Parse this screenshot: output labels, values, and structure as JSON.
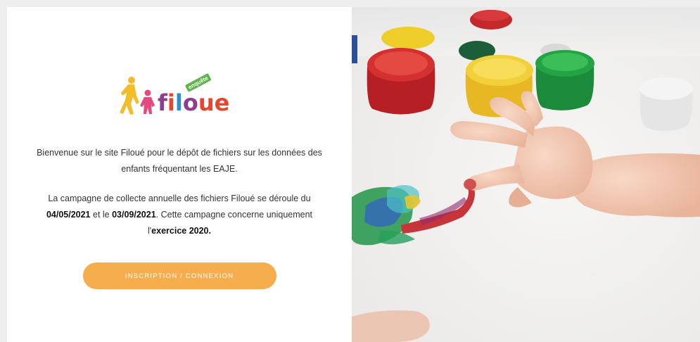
{
  "logo": {
    "word_letters": [
      "f",
      "i",
      "l",
      "o",
      "u",
      "e"
    ],
    "tag": "enquête",
    "colors": {
      "f": "#8e3d8f",
      "i": "#e6462e",
      "l": "#2c8fd1",
      "o": "#8e3d8f",
      "u": "#e6462e",
      "e": "#e6462e",
      "child_yellow": "#f2bd2c",
      "child_pink": "#e5497e",
      "tag_green": "#5bb547"
    }
  },
  "intro": {
    "line1": "Bienvenue sur le site Filoué pour le dépôt de fichiers sur les données des",
    "line2": "enfants fréquentant les EAJE."
  },
  "campaign": {
    "text1": "La campagne de collecte annuelle des fichiers Filoué se déroule du",
    "date_start": "04/05/2021",
    "text2": " et le ",
    "date_end": "03/09/2021",
    "text3": ". Cette campagne concerne uniquement",
    "text4": "l'",
    "exercise": "exercice 2020."
  },
  "cta": {
    "label": "INSCRIPTION / CONNEXION",
    "color": "#f6ad4e"
  },
  "hero_image": {
    "subject": "child-hand-finger-painting-with-paint-pots"
  }
}
